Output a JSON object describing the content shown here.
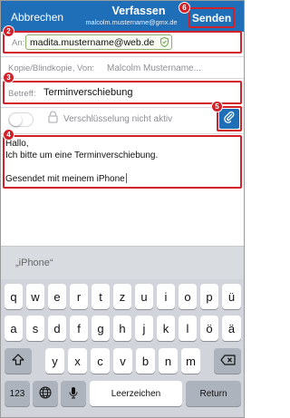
{
  "header": {
    "cancel_label": "Abbrechen",
    "title": "Verfassen",
    "subtitle": "malcolm.mustername@gmx.de",
    "send_label": "Senden"
  },
  "badges": {
    "send": "6",
    "to": "2",
    "subject": "3",
    "body": "4",
    "attach": "5"
  },
  "fields": {
    "to_label": "An:",
    "to_value": "madita.mustername@web.de",
    "cc_label": "Kopie/Blindkopie, Von:",
    "cc_value": "Malcolm Mustername...",
    "subject_label": "Betreff:",
    "subject_value": "Terminverschiebung",
    "encryption_label": "Verschlüsselung nicht aktiv"
  },
  "message_body": "Hallo,\nIch bitte um eine Terminverschiebung.\n\nGesendet mit meinem iPhone",
  "keyboard": {
    "prediction": "„iPhone“",
    "row1": [
      "q",
      "w",
      "e",
      "r",
      "t",
      "z",
      "u",
      "i",
      "o",
      "p",
      "ü"
    ],
    "row2": [
      "a",
      "s",
      "d",
      "f",
      "g",
      "h",
      "j",
      "k",
      "l",
      "ö",
      "ä"
    ],
    "row3": [
      "y",
      "x",
      "c",
      "v",
      "b",
      "n",
      "m"
    ],
    "numbers_label": "123",
    "space_label": "Leerzeichen",
    "return_label": "Return"
  },
  "colors": {
    "header_blue": "#1f6fb8",
    "highlight_red": "#d3212a",
    "chip_green": "#8bb26a"
  }
}
